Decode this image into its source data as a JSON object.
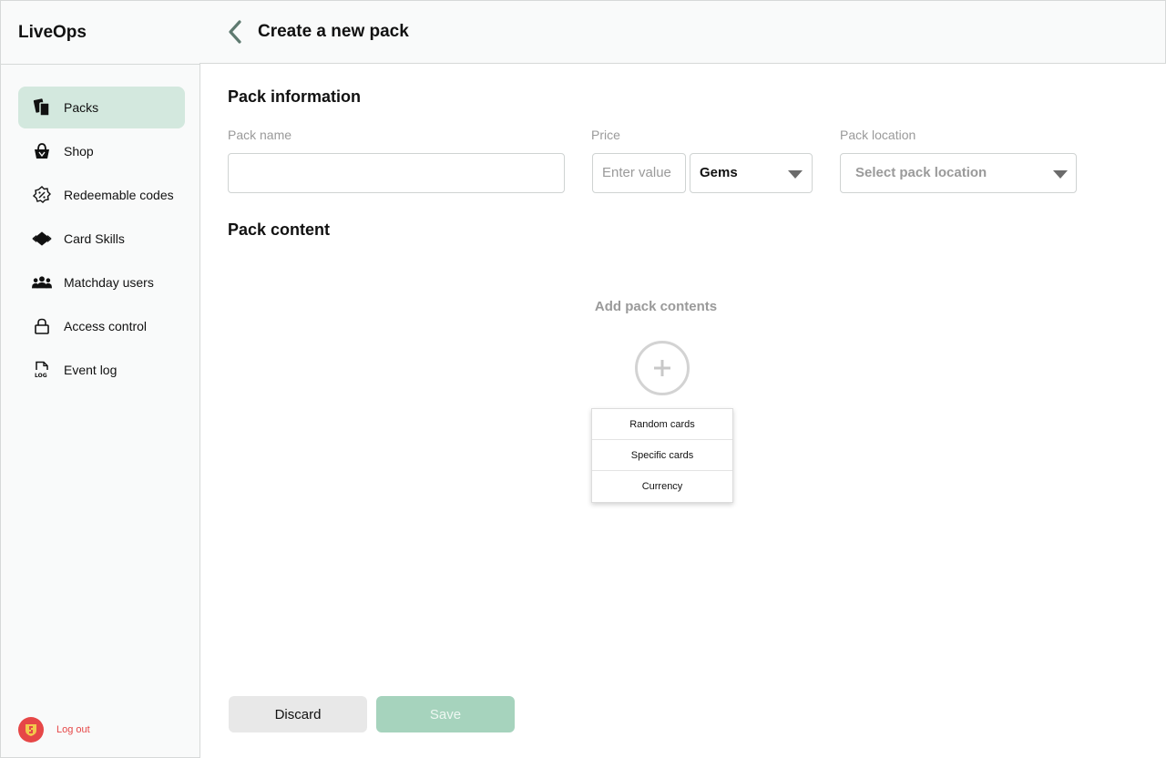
{
  "app": {
    "title": "LiveOps"
  },
  "sidebar": {
    "items": [
      {
        "label": "Packs",
        "icon": "cards-icon",
        "active": true
      },
      {
        "label": "Shop",
        "icon": "shopping-basket-icon",
        "active": false
      },
      {
        "label": "Redeemable codes",
        "icon": "discount-badge-icon",
        "active": false
      },
      {
        "label": "Card Skills",
        "icon": "diamond-icon",
        "active": false
      },
      {
        "label": "Matchday users",
        "icon": "users-icon",
        "active": false
      },
      {
        "label": "Access control",
        "icon": "lock-icon",
        "active": false
      },
      {
        "label": "Event log",
        "icon": "log-file-icon",
        "active": false
      }
    ],
    "logout_label": "Log out"
  },
  "header": {
    "title": "Create a new pack"
  },
  "form": {
    "section_info_title": "Pack information",
    "pack_name_label": "Pack name",
    "pack_name_value": "",
    "price_label": "Price",
    "price_placeholder": "Enter value",
    "currency_value": "Gems",
    "location_label": "Pack location",
    "location_placeholder": "Select pack location",
    "section_content_title": "Pack content",
    "add_contents_label": "Add pack contents",
    "add_menu_items": [
      "Random cards",
      "Specific cards",
      "Currency"
    ]
  },
  "actions": {
    "discard_label": "Discard",
    "save_label": "Save"
  },
  "colors": {
    "accent": "#d3e8de",
    "save_button": "#a6d3bd",
    "logout": "#e64747",
    "muted_text": "#9a9a9a"
  }
}
